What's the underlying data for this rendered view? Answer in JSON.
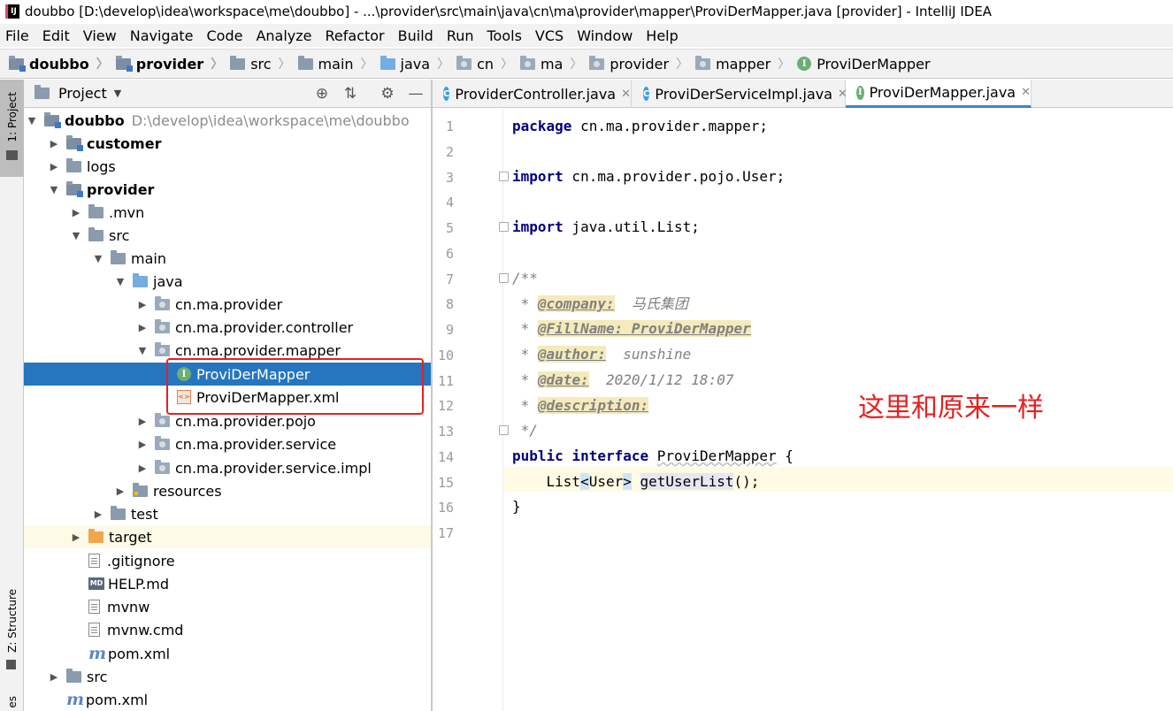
{
  "window": {
    "app_icon": "IJ",
    "title": "doubbo [D:\\develop\\idea\\workspace\\me\\doubbo] - ...\\provider\\src\\main\\java\\cn\\ma\\provider\\mapper\\ProviDerMapper.java [provider] - IntelliJ IDEA"
  },
  "menu": [
    "File",
    "Edit",
    "View",
    "Navigate",
    "Code",
    "Analyze",
    "Refactor",
    "Build",
    "Run",
    "Tools",
    "VCS",
    "Window",
    "Help"
  ],
  "breadcrumb": [
    "doubbo",
    "provider",
    "src",
    "main",
    "java",
    "cn",
    "ma",
    "provider",
    "mapper",
    "ProviDerMapper"
  ],
  "side_strip": {
    "project_tab": "1: Project",
    "structure_tab": "Z: Structure",
    "bottom_tab": "es"
  },
  "project_panel": {
    "title": "Project"
  },
  "tree": [
    {
      "label": "doubbo",
      "path": "D:\\develop\\idea\\workspace\\me\\doubbo"
    },
    {
      "label": "customer"
    },
    {
      "label": "logs"
    },
    {
      "label": "provider"
    },
    {
      "label": ".mvn"
    },
    {
      "label": "src"
    },
    {
      "label": "main"
    },
    {
      "label": "java"
    },
    {
      "label": "cn.ma.provider"
    },
    {
      "label": "cn.ma.provider.controller"
    },
    {
      "label": "cn.ma.provider.mapper"
    },
    {
      "label": "ProviDerMapper"
    },
    {
      "label": "ProviDerMapper.xml"
    },
    {
      "label": "cn.ma.provider.pojo"
    },
    {
      "label": "cn.ma.provider.service"
    },
    {
      "label": "cn.ma.provider.service.impl"
    },
    {
      "label": "resources"
    },
    {
      "label": "test"
    },
    {
      "label": "target"
    },
    {
      "label": ".gitignore"
    },
    {
      "label": "HELP.md"
    },
    {
      "label": "mvnw"
    },
    {
      "label": "mvnw.cmd"
    },
    {
      "label": "pom.xml"
    },
    {
      "label": "src"
    },
    {
      "label": "pom.xml"
    }
  ],
  "tabs": [
    {
      "label": "ProviderController.java"
    },
    {
      "label": "ProviDerServiceImpl.java"
    },
    {
      "label": "ProviDerMapper.java"
    }
  ],
  "line_numbers": [
    "1",
    "2",
    "3",
    "4",
    "5",
    "6",
    "7",
    "8",
    "9",
    "10",
    "11",
    "12",
    "13",
    "14",
    "15",
    "16",
    "17"
  ],
  "code": {
    "l1_kw": "package",
    "l1_rest": " cn.ma.provider.mapper;",
    "l3_kw": "import",
    "l3_rest": " cn.ma.provider.pojo.User;",
    "l5_kw": "import",
    "l5_rest": " java.util.List;",
    "l7": "/**",
    "l8_star": " * ",
    "l8_tag": "@company:",
    "l8_val": "  马氏集团",
    "l9_star": " * ",
    "l9_tag": "@FillName: ProviDerMapper",
    "l10_star": " * ",
    "l10_tag": "@author:",
    "l10_val": "  sunshine",
    "l11_star": " * ",
    "l11_tag": "@date:",
    "l11_val": "  2020/1/12 18:07",
    "l12_star": " * ",
    "l12_tag": "@description:",
    "l13": " */",
    "l14_kw1": "public",
    "l14_kw2": "interface",
    "l14_name": "ProviDerMapper",
    "l14_brace": " {",
    "l15_indent": "    List",
    "l15_open": "<",
    "l15_type": "User",
    "l15_close": ">",
    "l15_sp": " ",
    "l15_meth": "getUserList",
    "l15_end": "();",
    "l16": "}"
  },
  "annotation": "这里和原来一样"
}
